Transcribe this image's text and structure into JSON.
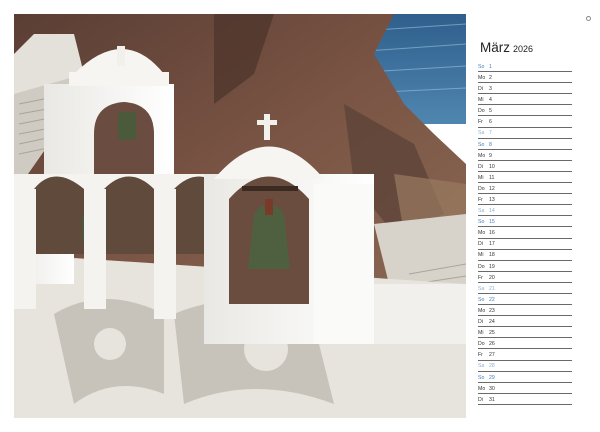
{
  "calendar": {
    "month": "März",
    "year": "2026",
    "days": [
      {
        "wd": "So",
        "d": "1",
        "type": "sun"
      },
      {
        "wd": "Mo",
        "d": "2",
        "type": "wk"
      },
      {
        "wd": "Di",
        "d": "3",
        "type": "wk"
      },
      {
        "wd": "Mi",
        "d": "4",
        "type": "wk"
      },
      {
        "wd": "Do",
        "d": "5",
        "type": "wk"
      },
      {
        "wd": "Fr",
        "d": "6",
        "type": "wk"
      },
      {
        "wd": "Sa",
        "d": "7",
        "type": "sat"
      },
      {
        "wd": "So",
        "d": "8",
        "type": "sun"
      },
      {
        "wd": "Mo",
        "d": "9",
        "type": "wk"
      },
      {
        "wd": "Di",
        "d": "10",
        "type": "wk"
      },
      {
        "wd": "Mi",
        "d": "11",
        "type": "wk"
      },
      {
        "wd": "Do",
        "d": "12",
        "type": "wk"
      },
      {
        "wd": "Fr",
        "d": "13",
        "type": "wk"
      },
      {
        "wd": "Sa",
        "d": "14",
        "type": "sat"
      },
      {
        "wd": "So",
        "d": "15",
        "type": "sun"
      },
      {
        "wd": "Mo",
        "d": "16",
        "type": "wk"
      },
      {
        "wd": "Di",
        "d": "17",
        "type": "wk"
      },
      {
        "wd": "Mi",
        "d": "18",
        "type": "wk"
      },
      {
        "wd": "Do",
        "d": "19",
        "type": "wk"
      },
      {
        "wd": "Fr",
        "d": "20",
        "type": "wk"
      },
      {
        "wd": "Sa",
        "d": "21",
        "type": "sat"
      },
      {
        "wd": "So",
        "d": "22",
        "type": "sun"
      },
      {
        "wd": "Mo",
        "d": "23",
        "type": "wk"
      },
      {
        "wd": "Di",
        "d": "24",
        "type": "wk"
      },
      {
        "wd": "Mi",
        "d": "25",
        "type": "wk"
      },
      {
        "wd": "Do",
        "d": "26",
        "type": "wk"
      },
      {
        "wd": "Fr",
        "d": "27",
        "type": "wk"
      },
      {
        "wd": "Sa",
        "d": "28",
        "type": "sat"
      },
      {
        "wd": "So",
        "d": "29",
        "type": "sun"
      },
      {
        "wd": "Mo",
        "d": "30",
        "type": "wk"
      },
      {
        "wd": "Di",
        "d": "31",
        "type": "wk"
      }
    ]
  },
  "colors": {
    "sunday": "#3f7fbf",
    "saturday": "#8fb0d0",
    "weekday": "#333333",
    "sea": "#3a6f9a",
    "cliff": "#6e4a3a",
    "whitewash": "#f4f3ef"
  }
}
